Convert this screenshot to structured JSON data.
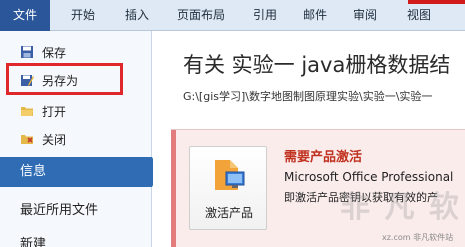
{
  "ribbon": {
    "tabs": [
      "文件",
      "开始",
      "插入",
      "页面布局",
      "引用",
      "邮件",
      "审阅",
      "视图"
    ]
  },
  "backstage": {
    "commands": [
      {
        "label": "保存",
        "icon": "save-icon"
      },
      {
        "label": "另存为",
        "icon": "save-as-icon"
      },
      {
        "label": "打开",
        "icon": "open-folder-icon"
      },
      {
        "label": "关闭",
        "icon": "close-document-icon"
      }
    ],
    "nav": {
      "info": "信息",
      "recent": "最近所用文件",
      "new": "新建"
    }
  },
  "info": {
    "title": "有关 实验一 java栅格数据结",
    "path": "G:\\[gis学习]\\数字地图制图原理实验\\实验一\\实验一"
  },
  "activation": {
    "button_label": "激活产品",
    "heading": "需要产品激活",
    "line1": "Microsoft Office Professional",
    "line2": "即激活产品密钥以获取有效的产"
  },
  "watermark": {
    "large": "非 凡 软 件",
    "small": "xz.com 非凡软件站"
  },
  "colors": {
    "file_tab": "#2b579a",
    "selected_nav": "#2f6cb4",
    "highlight_box": "#e0282c",
    "activation_heading": "#c0311f"
  }
}
